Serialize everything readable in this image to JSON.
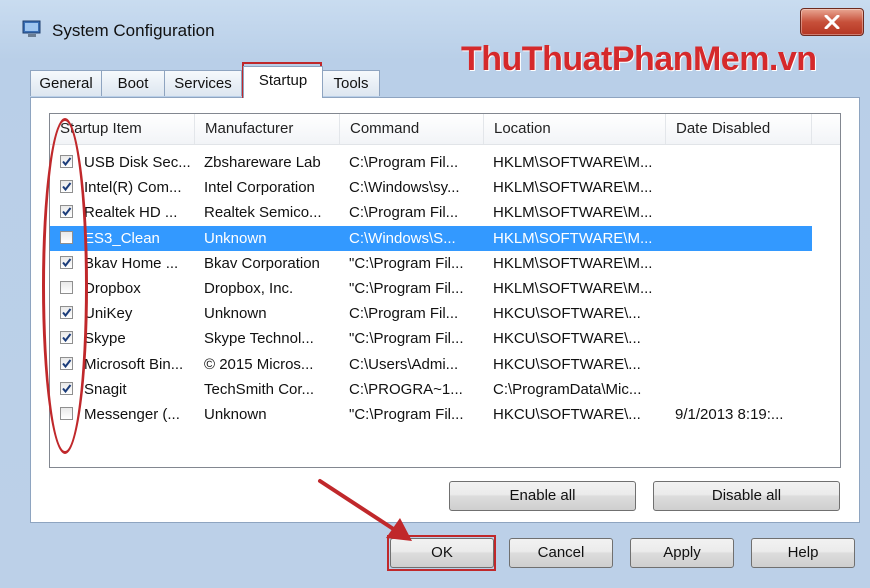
{
  "window": {
    "title": "System Configuration",
    "brand": "ThuThuatPhanMem.vn"
  },
  "tabs": [
    {
      "label": "General"
    },
    {
      "label": "Boot"
    },
    {
      "label": "Services"
    },
    {
      "label": "Startup"
    },
    {
      "label": "Tools"
    }
  ],
  "table": {
    "columns": [
      "Startup Item",
      "Manufacturer",
      "Command",
      "Location",
      "Date Disabled"
    ],
    "rows": [
      {
        "checked": true,
        "item": "USB Disk Sec...",
        "manufacturer": "Zbshareware Lab",
        "command": "C:\\Program Fil...",
        "location": "HKLM\\SOFTWARE\\M...",
        "date": ""
      },
      {
        "checked": true,
        "item": "Intel(R) Com...",
        "manufacturer": "Intel Corporation",
        "command": "C:\\Windows\\sy...",
        "location": "HKLM\\SOFTWARE\\M...",
        "date": ""
      },
      {
        "checked": true,
        "item": "Realtek HD ...",
        "manufacturer": "Realtek Semico...",
        "command": "C:\\Program Fil...",
        "location": "HKLM\\SOFTWARE\\M...",
        "date": ""
      },
      {
        "checked": false,
        "item": "ES3_Clean",
        "manufacturer": "Unknown",
        "command": "C:\\Windows\\S...",
        "location": "HKLM\\SOFTWARE\\M...",
        "date": "",
        "selected": true
      },
      {
        "checked": true,
        "item": "Bkav Home ...",
        "manufacturer": "Bkav Corporation",
        "command": "\"C:\\Program Fil...",
        "location": "HKLM\\SOFTWARE\\M...",
        "date": ""
      },
      {
        "checked": false,
        "item": "Dropbox",
        "manufacturer": "Dropbox, Inc.",
        "command": "\"C:\\Program Fil...",
        "location": "HKLM\\SOFTWARE\\M...",
        "date": ""
      },
      {
        "checked": true,
        "item": "UniKey",
        "manufacturer": "Unknown",
        "command": "C:\\Program Fil...",
        "location": "HKCU\\SOFTWARE\\...",
        "date": ""
      },
      {
        "checked": true,
        "item": "Skype",
        "manufacturer": "Skype Technol...",
        "command": "\"C:\\Program Fil...",
        "location": "HKCU\\SOFTWARE\\...",
        "date": ""
      },
      {
        "checked": true,
        "item": "Microsoft Bin...",
        "manufacturer": "© 2015 Micros...",
        "command": "C:\\Users\\Admi...",
        "location": "HKCU\\SOFTWARE\\...",
        "date": ""
      },
      {
        "checked": true,
        "item": "Snagit",
        "manufacturer": "TechSmith Cor...",
        "command": "C:\\PROGRA~1...",
        "location": "C:\\ProgramData\\Mic...",
        "date": ""
      },
      {
        "checked": false,
        "item": "Messenger (...",
        "manufacturer": "Unknown",
        "command": "\"C:\\Program Fil...",
        "location": "HKCU\\SOFTWARE\\...",
        "date": "9/1/2013 8:19:..."
      }
    ]
  },
  "buttons": {
    "enable_all": "Enable all",
    "disable_all": "Disable all",
    "ok": "OK",
    "cancel": "Cancel",
    "apply": "Apply",
    "help": "Help"
  },
  "colors": {
    "selection": "#3399ff",
    "annotation": "#c0282b",
    "brand": "#d5292b"
  }
}
